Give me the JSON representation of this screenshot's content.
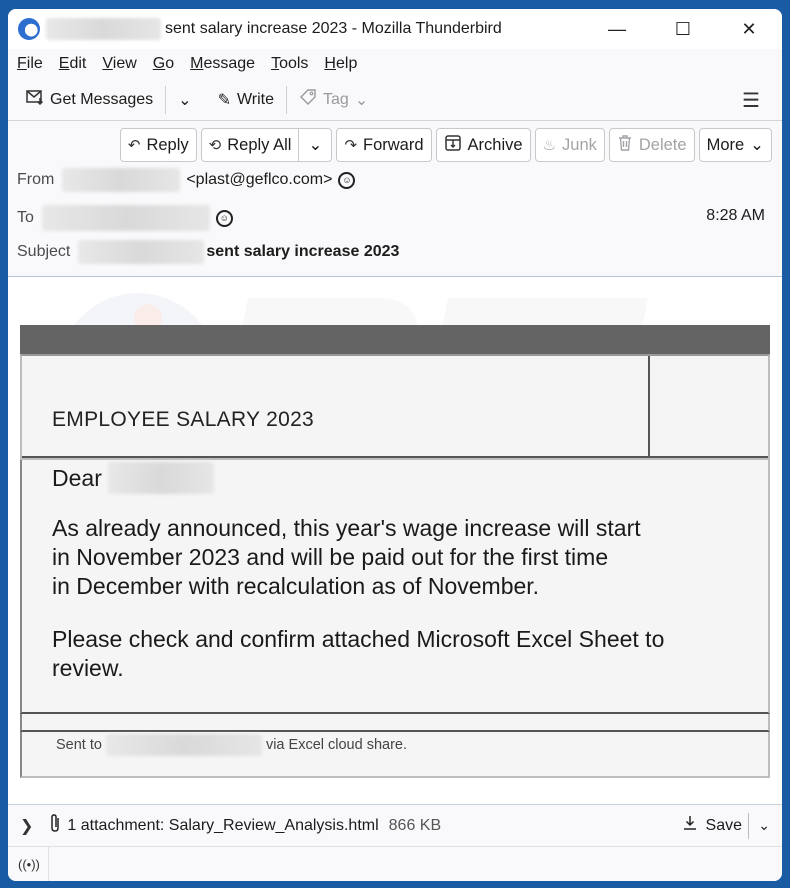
{
  "window": {
    "title": "sent salary increase 2023 - Mozilla Thunderbird",
    "controls": {
      "minimize": "—",
      "maximize": "☐",
      "close": "✕"
    }
  },
  "menu": [
    {
      "u": "F",
      "rest": "ile"
    },
    {
      "u": "E",
      "rest": "dit"
    },
    {
      "u": "V",
      "rest": "iew"
    },
    {
      "u": "G",
      "rest": "o"
    },
    {
      "u": "M",
      "rest": "essage"
    },
    {
      "u": "T",
      "rest": "ools"
    },
    {
      "u": "H",
      "rest": "elp"
    }
  ],
  "toolbar": {
    "get_messages": "Get Messages",
    "write": "Write",
    "tag": "Tag"
  },
  "actions": {
    "reply": "Reply",
    "reply_all": "Reply All",
    "forward": "Forward",
    "archive": "Archive",
    "junk": "Junk",
    "delete": "Delete",
    "more": "More"
  },
  "header": {
    "from_label": "From",
    "from_email": "<plast@geflco.com>",
    "to_label": "To",
    "time": "8:28 AM",
    "subject_label": "Subject",
    "subject": "sent salary increase 2023"
  },
  "email": {
    "title": "EMPLOYEE  SALARY  2023",
    "greeting": "Dear",
    "paragraph1": "As already announced, this year's wage increase will start in November 2023 and will be paid out for the first time in December with recalculation as of November.",
    "paragraph1_lines": [
      "As already announced, this year's wage increase will start",
      "in November 2023 and will be paid out for the first time",
      "in December with recalculation as of November."
    ],
    "paragraph2": "Please check and confirm attached Microsoft Excel Sheet to review.",
    "footer_prefix": "Sent to",
    "footer_suffix": "via Excel cloud  share."
  },
  "attachment": {
    "label": "1 attachment: Salary_Review_Analysis.html",
    "size": "866 KB",
    "save": "Save"
  }
}
